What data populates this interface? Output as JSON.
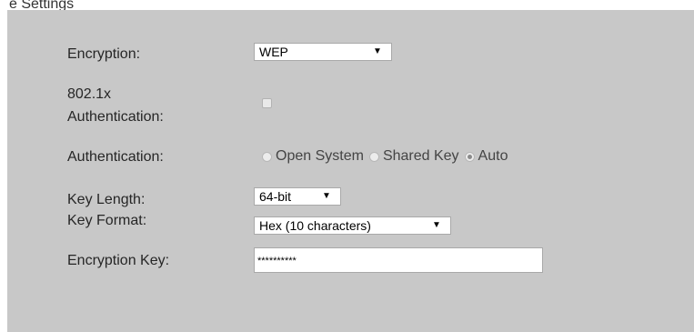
{
  "partial_heading": "e Settings",
  "form": {
    "encryption": {
      "label": "Encryption:",
      "value": "WEP"
    },
    "dot1x": {
      "label_line1": "802.1x",
      "label_line2": "Authentication:",
      "checked": false
    },
    "authentication": {
      "label": "Authentication:",
      "options": [
        "Open System",
        "Shared Key",
        "Auto"
      ],
      "selected": "Auto"
    },
    "key_length": {
      "label": "Key Length:",
      "value": "64-bit"
    },
    "key_format": {
      "label": "Key Format:",
      "value": "Hex (10 characters)"
    },
    "encryption_key": {
      "label": "Encryption Key:",
      "value": "**********"
    }
  },
  "icons": {
    "dropdown": "caret-down-icon"
  },
  "colors": {
    "panel_bg": "#c8c8c8",
    "input_bg": "#ffffff",
    "border": "#a9a9a9"
  }
}
